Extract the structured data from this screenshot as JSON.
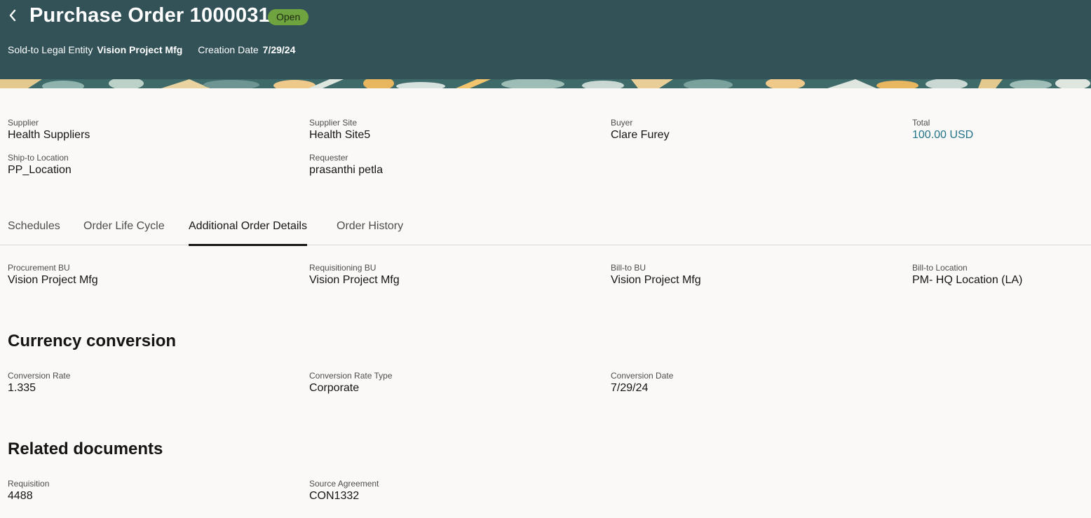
{
  "header": {
    "title": "Purchase Order 1000031",
    "status": "Open",
    "sold_to_label": "Sold-to Legal Entity",
    "sold_to_value": "Vision Project Mfg",
    "creation_label": "Creation Date",
    "creation_value": "7/29/24"
  },
  "summary": {
    "supplier": {
      "label": "Supplier",
      "value": "Health Suppliers"
    },
    "supplier_site": {
      "label": "Supplier Site",
      "value": "Health Site5"
    },
    "buyer": {
      "label": "Buyer",
      "value": "Clare Furey"
    },
    "total": {
      "label": "Total",
      "value": "100.00 USD"
    },
    "ship_to": {
      "label": "Ship-to Location",
      "value": "PP_Location"
    },
    "requester": {
      "label": "Requester",
      "value": "prasanthi petla"
    }
  },
  "tabs": [
    {
      "label": "Schedules"
    },
    {
      "label": "Order Life Cycle"
    },
    {
      "label": "Additional Order Details"
    },
    {
      "label": "Order History"
    }
  ],
  "active_tab": "Additional Order Details",
  "details": {
    "procurement_bu": {
      "label": "Procurement BU",
      "value": "Vision Project Mfg"
    },
    "requisitioning_bu": {
      "label": "Requisitioning BU",
      "value": "Vision Project Mfg"
    },
    "bill_to_bu": {
      "label": "Bill-to BU",
      "value": "Vision Project Mfg"
    },
    "bill_to_location": {
      "label": "Bill-to Location",
      "value": "PM- HQ Location (LA)"
    }
  },
  "currency": {
    "title": "Currency conversion",
    "rate": {
      "label": "Conversion Rate",
      "value": "1.335"
    },
    "rate_type": {
      "label": "Conversion Rate Type",
      "value": "Corporate"
    },
    "date": {
      "label": "Conversion Date",
      "value": "7/29/24"
    }
  },
  "related": {
    "title": "Related documents",
    "requisition": {
      "label": "Requisition",
      "value": "4488"
    },
    "source_agreement": {
      "label": "Source Agreement",
      "value": "CON1332"
    }
  },
  "colors": {
    "header_bg": "#325258",
    "status_badge": "#6ea33f",
    "link": "#227288",
    "page_bg": "#faf9f7"
  },
  "icons": {
    "back": "chevron-left-icon"
  }
}
